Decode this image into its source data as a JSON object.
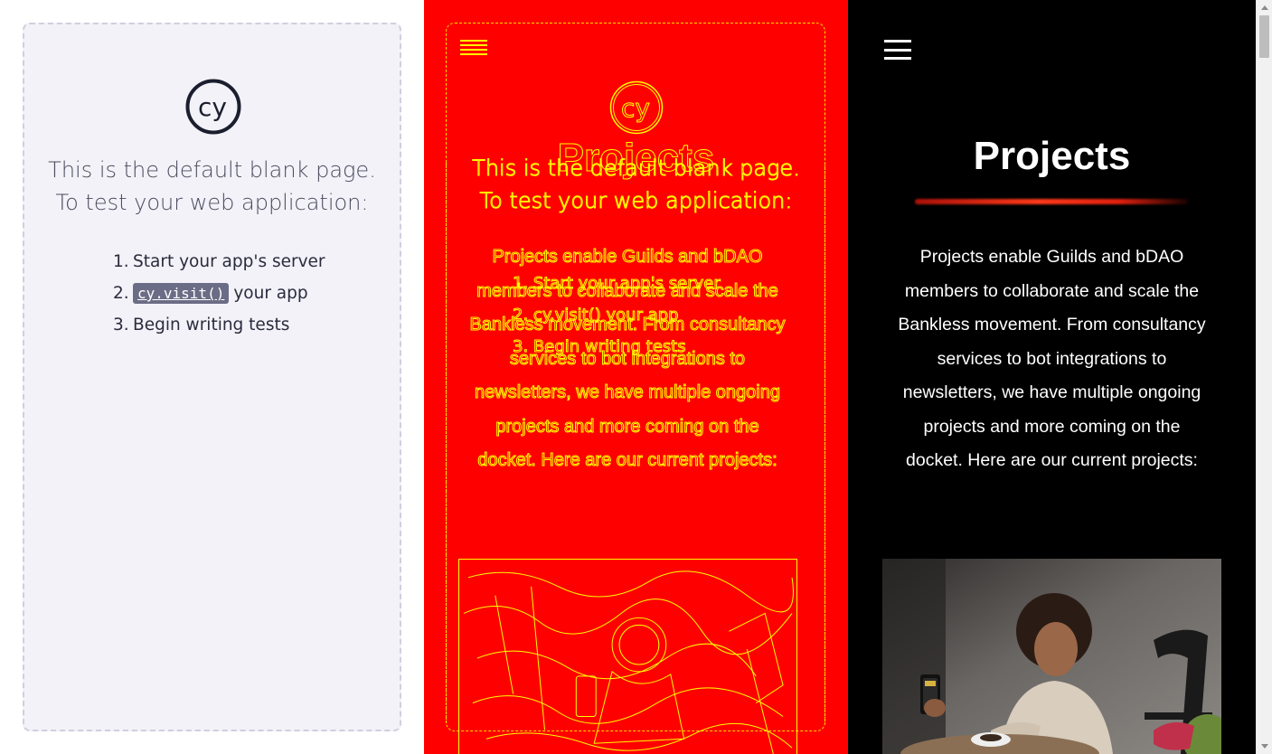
{
  "blank_page": {
    "heading_line1": "This is the default blank page.",
    "heading_line2": "To test your web application:",
    "steps": [
      {
        "num": "1.",
        "text": "Start your app's server"
      },
      {
        "num": "2.",
        "code": "cy.visit()",
        "text": "your app"
      },
      {
        "num": "3.",
        "text": "Begin writing tests"
      }
    ],
    "logo_text": "cy"
  },
  "projects_page": {
    "title": "Projects",
    "body": "Projects enable Guilds and bDAO members to collaborate and scale the Bankless movement. From consultancy services to bot integrations to newsletters, we have multiple ongoing projects and more coming on the docket. Here are our current projects:",
    "menu_icon": "hamburger-menu-icon"
  },
  "colors": {
    "diff_background": "#ff0000",
    "diff_outline": "#ffff00",
    "projects_background": "#000000",
    "blank_card_background": "#f3f2f8",
    "accent_underline": "#ff3a1a"
  }
}
